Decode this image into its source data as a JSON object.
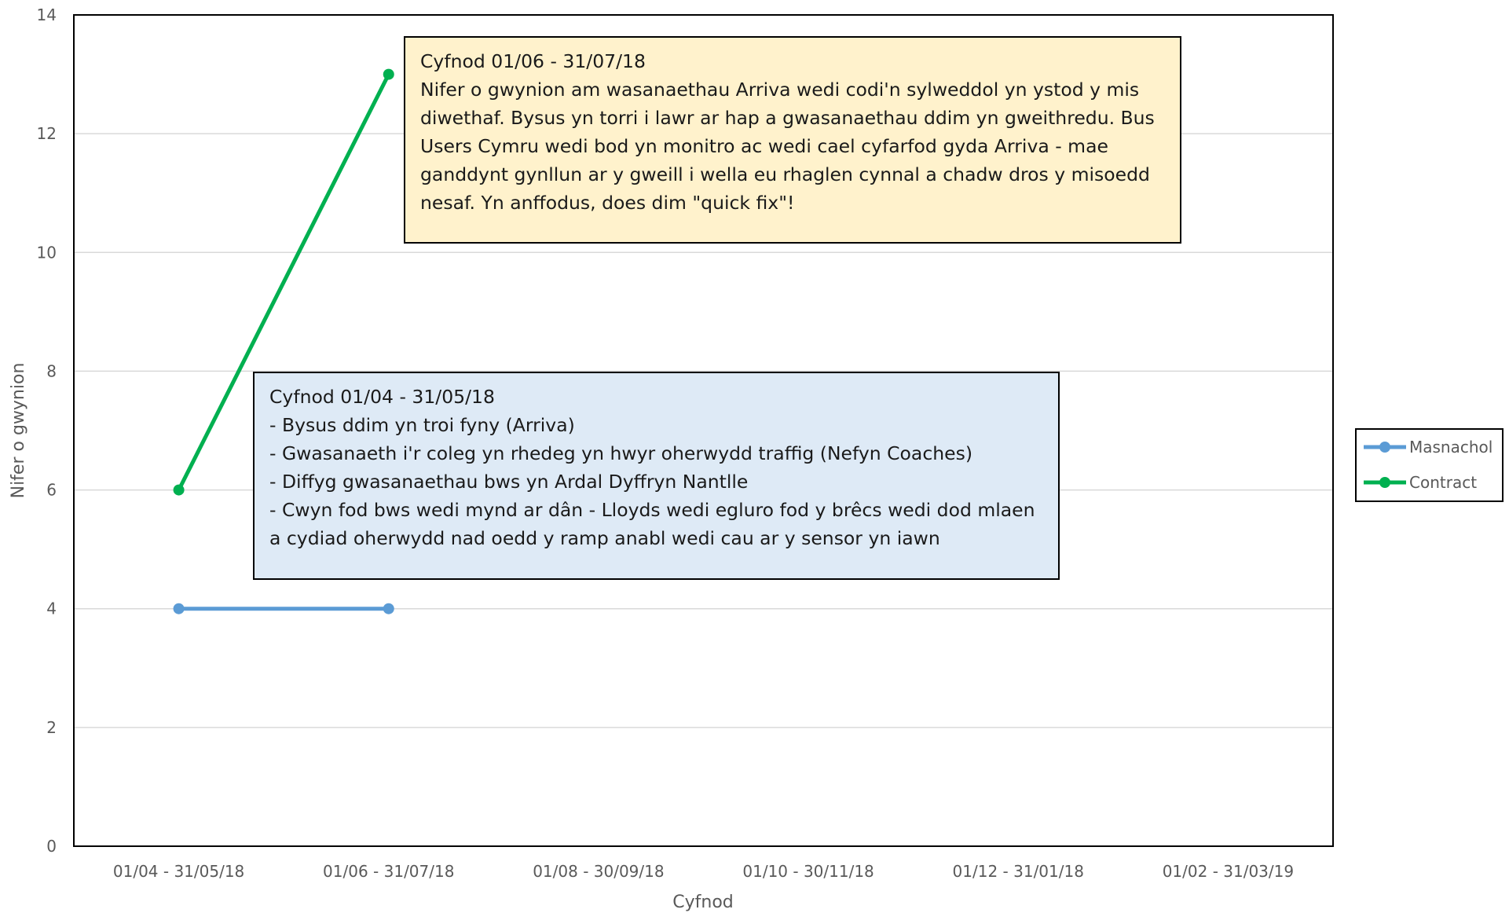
{
  "chart_data": {
    "type": "line",
    "title": "",
    "xlabel": "Cyfnod",
    "ylabel": "Nifer o gwynion",
    "categories": [
      "01/04 - 31/05/18",
      "01/06 - 31/07/18",
      "01/08 - 30/09/18",
      "01/10 - 30/11/18",
      "01/12 - 31/01/18",
      "01/02 - 31/03/19"
    ],
    "ylim": [
      0,
      14
    ],
    "yticks": [
      "0",
      "2",
      "4",
      "6",
      "8",
      "10",
      "12",
      "14"
    ],
    "grid": true,
    "legend_position": "right",
    "series": [
      {
        "name": "Masnachol",
        "color": "#5B9BD5",
        "values": [
          4,
          4,
          null,
          null,
          null,
          null
        ]
      },
      {
        "name": "Contract",
        "color": "#00B050",
        "values": [
          6,
          13,
          null,
          null,
          null,
          null
        ]
      }
    ],
    "annotations": [
      {
        "id": "note_jun",
        "background": "#FFF2CC",
        "lines": [
          "Cyfnod 01/06 - 31/07/18",
          "Nifer o gwynion am wasanaethau Arriva wedi codi'n sylweddol yn ystod y mis",
          "diwethaf. Bysus yn torri i lawr ar hap a gwasanaethau ddim yn gweithredu. Bus",
          "Users Cymru wedi bod yn monitro ac wedi cael cyfarfod gyda Arriva - mae",
          "ganddynt gynllun ar y gweill i wella eu rhaglen cynnal a chadw dros y misoedd",
          "nesaf. Yn anffodus, does dim \"quick fix\"!"
        ]
      },
      {
        "id": "note_apr",
        "background": "#DEEAF6",
        "lines": [
          "Cyfnod 01/04 - 31/05/18",
          "- Bysus ddim yn troi fyny (Arriva)",
          "- Gwasanaeth i'r coleg yn rhedeg yn hwyr oherwydd traffig (Nefyn Coaches)",
          "- Diffyg gwasanaethau bws yn Ardal Dyffryn Nantlle",
          "- Cwyn fod bws wedi mynd ar dân - Lloyds wedi egluro fod y brêcs wedi dod mlaen",
          "a cydiad oherwydd nad oedd y ramp anabl wedi cau ar y sensor yn iawn"
        ]
      }
    ]
  }
}
